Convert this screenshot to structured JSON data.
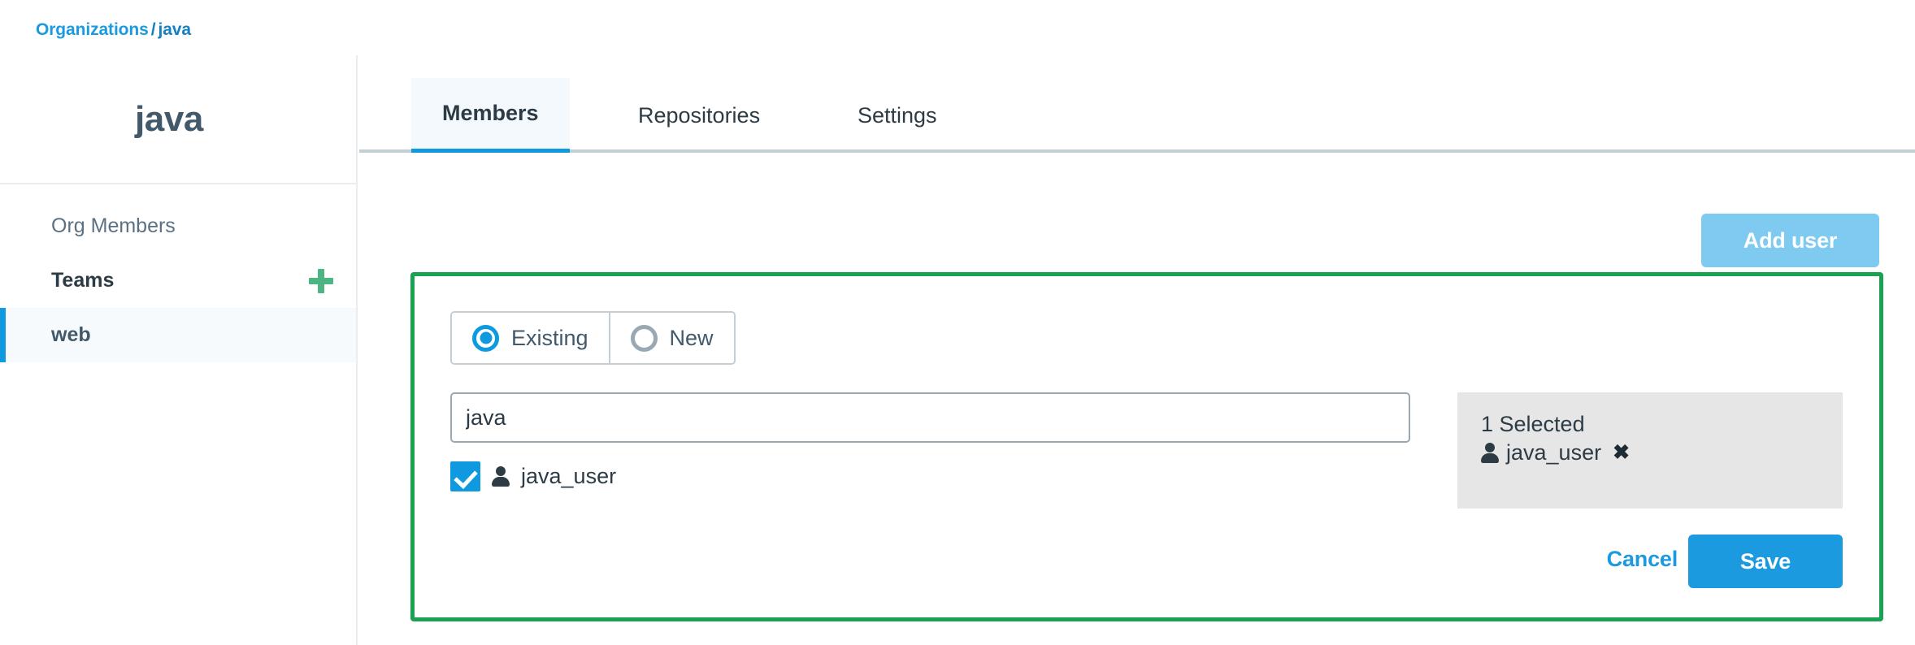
{
  "breadcrumb": {
    "root": "Organizations",
    "separator": "/",
    "current": "java"
  },
  "sidebar": {
    "title": "java",
    "items": [
      {
        "label": "Org Members",
        "style": "muted",
        "active": false,
        "has_plus": false
      },
      {
        "label": "Teams",
        "style": "strong",
        "active": false,
        "has_plus": true
      },
      {
        "label": "web",
        "style": "strong",
        "active": true,
        "has_plus": false
      }
    ],
    "add_team_icon": "plus-icon"
  },
  "tabs": [
    {
      "label": "Members",
      "active": true
    },
    {
      "label": "Repositories",
      "active": false
    },
    {
      "label": "Settings",
      "active": false
    }
  ],
  "toolbar": {
    "add_user_label": "Add user"
  },
  "add_panel": {
    "mode_options": [
      {
        "label": "Existing",
        "selected": true
      },
      {
        "label": "New",
        "selected": false
      }
    ],
    "search": {
      "value": "java",
      "placeholder": ""
    },
    "results": [
      {
        "name": "java_user",
        "checked": true,
        "icon": "person-icon"
      }
    ],
    "selected": {
      "count_label": "1 Selected",
      "items": [
        {
          "name": "java_user",
          "icon": "person-icon",
          "remove_icon": "✖"
        }
      ]
    },
    "cancel_label": "Cancel",
    "save_label": "Save"
  },
  "colors": {
    "accent_blue": "#1b9ae0",
    "disabled_blue": "#7fcaf0",
    "panel_green": "#19a24f",
    "plus_green": "#4cb581",
    "text_dark": "#2d3b45",
    "text_slate": "#41596b",
    "selected_bg": "#e6e6e6",
    "active_nav_bg": "#f6fafd"
  }
}
